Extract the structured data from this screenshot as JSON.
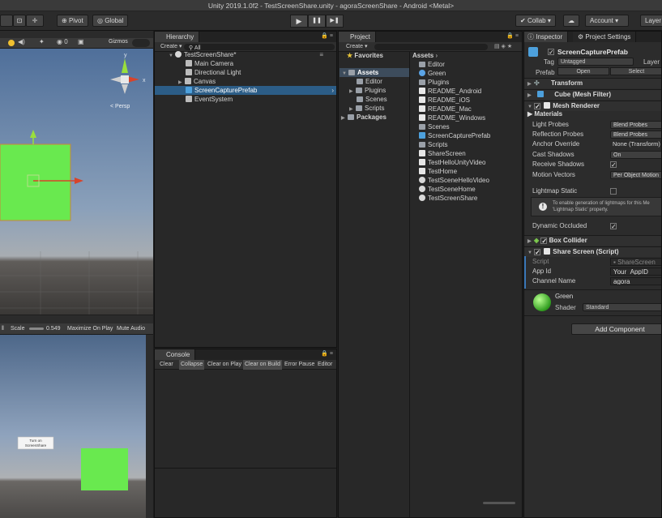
{
  "window": {
    "title": "Unity 2019.1.0f2 - TestScreenShare.unity - agoraScreenShare - Android <Metal>"
  },
  "toolbar": {
    "pivot": "Pivot",
    "global": "Global",
    "play": "▶",
    "pause": "❚❚",
    "step": "▶❚",
    "collab": "Collab",
    "account": "Account",
    "layers": "Layer"
  },
  "scene_view": {
    "gizmos": "Gizmos",
    "persp": "< Persp",
    "axis_y": "y",
    "axis_x": "x",
    "cube_color": "#69e94f"
  },
  "game_view": {
    "scale_label": "Scale",
    "scale_value": "0.549",
    "maximize": "Maximize On Play",
    "mute": "Mute Audio",
    "button_line1": "Turn on",
    "button_line2": "ScreenShare"
  },
  "hierarchy": {
    "tab": "Hierarchy",
    "create": "Create",
    "search": "All",
    "scene": "TestScreenShare*",
    "items": [
      "Main Camera",
      "Directional Light",
      "Canvas",
      "ScreenCapturePrefab",
      "EventSystem"
    ]
  },
  "project": {
    "tab": "Project",
    "create": "Create",
    "favorites": "Favorites",
    "assets_root": "Assets",
    "tree": [
      "Editor",
      "Plugins",
      "Scenes",
      "Scripts"
    ],
    "packages": "Packages",
    "breadcrumb": "Assets",
    "files": [
      "Editor",
      "Green",
      "Plugins",
      "README_Android",
      "README_iOS",
      "README_Mac",
      "README_Windows",
      "Scenes",
      "ScreenCapturePrefab",
      "Scripts",
      "ShareScreen",
      "TestHelloUnityVideo",
      "TestHome",
      "TestSceneHelloVideo",
      "TestSceneHome",
      "TestScreenShare"
    ]
  },
  "console": {
    "tab": "Console",
    "buttons": [
      "Clear",
      "Collapse",
      "Clear on Play",
      "Clear on Build",
      "Error Pause",
      "Editor"
    ]
  },
  "inspector": {
    "tab": "Inspector",
    "tab2": "Project Settings",
    "object_name": "ScreenCapturePrefab",
    "tag_label": "Tag",
    "tag_value": "Untagged",
    "layer_label": "Layer",
    "prefab_label": "Prefab",
    "open_btn": "Open",
    "select_btn": "Select",
    "components": {
      "transform": "Transform",
      "mesh_filter": "Cube (Mesh Filter)",
      "mesh_renderer": "Mesh Renderer",
      "box_collider": "Box Collider",
      "share_screen": "Share Screen (Script)"
    },
    "materials": "Materials",
    "light_probes": {
      "label": "Light Probes",
      "value": "Blend Probes"
    },
    "reflection_probes": {
      "label": "Reflection Probes",
      "value": "Blend Probes"
    },
    "anchor_override": {
      "label": "Anchor Override",
      "value": "None (Transform)"
    },
    "cast_shadows": {
      "label": "Cast Shadows",
      "value": "On"
    },
    "receive_shadows": {
      "label": "Receive Shadows"
    },
    "motion_vectors": {
      "label": "Motion Vectors",
      "value": "Per Object Motion"
    },
    "lightmap_static": {
      "label": "Lightmap Static"
    },
    "info_line1": "To enable generation of lightmaps for this Me",
    "info_line2": "'Lightmap Static' property.",
    "dynamic_occluded": {
      "label": "Dynamic Occluded"
    },
    "script": {
      "label": "Script",
      "value": "ShareScreen"
    },
    "app_id": {
      "label": "App Id",
      "value": "Your_AppID"
    },
    "channel_name": {
      "label": "Channel Name",
      "value": "agora"
    },
    "material_name": "Green",
    "shader_label": "Shader",
    "shader_value": "Standard",
    "add_component": "Add Component"
  }
}
